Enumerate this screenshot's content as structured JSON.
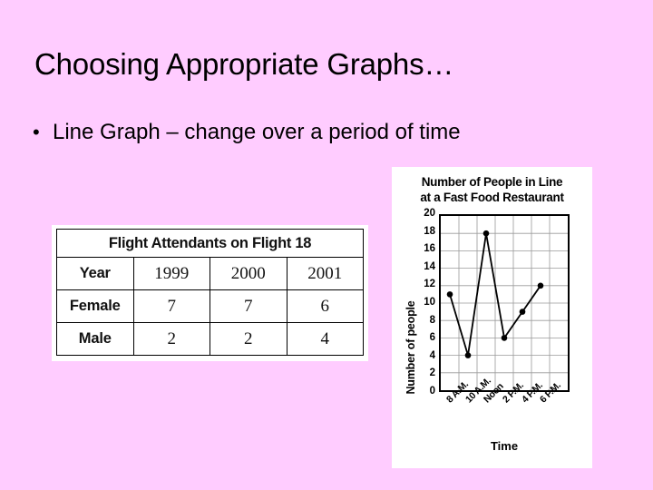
{
  "slide": {
    "background_color": "#ffccff",
    "title": "Choosing Appropriate Graphs…",
    "bullets": [
      {
        "marker": "•",
        "text": "Line Graph – change over a period of time"
      }
    ]
  },
  "table_figure": {
    "title": "Flight Attendants on Flight 18",
    "columns": [
      "Year",
      "1999",
      "2000",
      "2001"
    ],
    "rows": [
      {
        "label": "Female",
        "values": [
          "7",
          "7",
          "6"
        ]
      },
      {
        "label": "Male",
        "values": [
          "2",
          "2",
          "4"
        ]
      }
    ]
  },
  "chart_data": {
    "type": "line",
    "title": "Number of People in Line at a Fast Food Restaurant",
    "title_line1": "Number of People in Line",
    "title_line2": "at a Fast Food Restaurant",
    "xlabel": "Time",
    "ylabel": "Number of people",
    "categories": [
      "8 A.M.",
      "10 A.M.",
      "Noon",
      "2 P.M.",
      "4 P.M.",
      "6 P.M."
    ],
    "values": [
      11,
      4,
      18,
      6,
      9,
      12
    ],
    "ylim": [
      0,
      20
    ],
    "ytick_step": 2,
    "yticks": [
      20,
      18,
      16,
      14,
      12,
      10,
      8,
      6,
      4,
      2,
      0
    ],
    "grid": true,
    "legend": "none",
    "marker": "filled-circle",
    "line_color": "#000000",
    "grid_color": "#9a9a9a",
    "columns_in_grid": 7
  }
}
